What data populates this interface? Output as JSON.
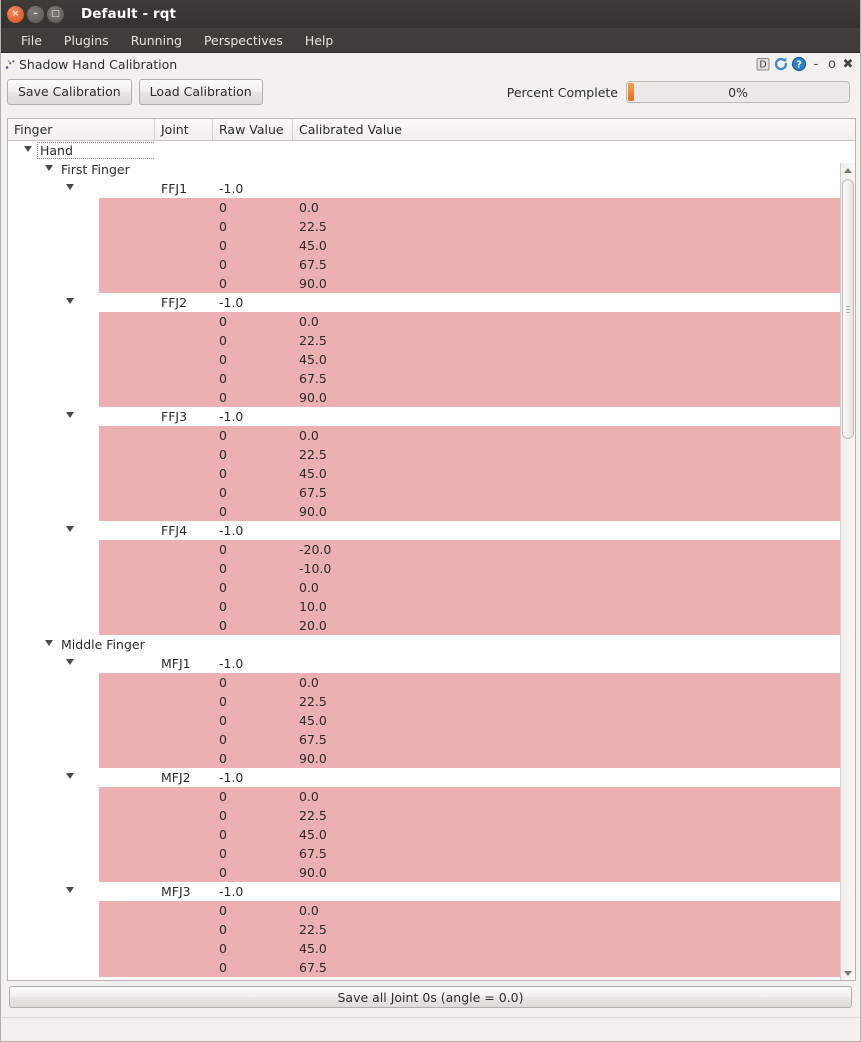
{
  "window": {
    "title": "Default - rqt",
    "buttons": [
      {
        "name": "close",
        "glyph": "×"
      },
      {
        "name": "minimize",
        "glyph": "–"
      },
      {
        "name": "maximize",
        "glyph": "□"
      }
    ]
  },
  "menubar": {
    "items": [
      "File",
      "Plugins",
      "Running",
      "Perspectives",
      "Help"
    ]
  },
  "dock": {
    "title": "Shadow Hand Calibration",
    "icon": "plugin-icon",
    "buttons": [
      {
        "name": "dock-d-button",
        "label": "D"
      },
      {
        "name": "reload-button",
        "label": "↻"
      },
      {
        "name": "help-button",
        "label": "?"
      },
      {
        "name": "minimize-button",
        "label": "-"
      },
      {
        "name": "float-button",
        "label": "o"
      },
      {
        "name": "close-button",
        "label": "✖"
      }
    ]
  },
  "toolbar": {
    "save_calibration_label": "Save Calibration",
    "load_calibration_label": "Load Calibration",
    "percent_complete_label": "Percent Complete",
    "percent_complete_value": "0%",
    "percent_complete_number": 0,
    "progress_accent_color": "#e8701b"
  },
  "tree": {
    "columns": [
      "Finger",
      "Joint",
      "Raw Value",
      "Calibrated Value"
    ],
    "data_row_color": "#ecb0b3",
    "rows": [
      {
        "kind": "node",
        "level": 0,
        "label": "Hand",
        "focused": true,
        "joint": "",
        "raw": "",
        "cal": ""
      },
      {
        "kind": "node",
        "level": 1,
        "label": "First Finger",
        "focused": false,
        "joint": "",
        "raw": "",
        "cal": ""
      },
      {
        "kind": "node",
        "level": 2,
        "label": "",
        "focused": false,
        "joint": "FFJ1",
        "raw": "-1.0",
        "cal": ""
      },
      {
        "kind": "data",
        "joint": "",
        "raw": "0",
        "cal": "0.0"
      },
      {
        "kind": "data",
        "joint": "",
        "raw": "0",
        "cal": "22.5"
      },
      {
        "kind": "data",
        "joint": "",
        "raw": "0",
        "cal": "45.0"
      },
      {
        "kind": "data",
        "joint": "",
        "raw": "0",
        "cal": "67.5"
      },
      {
        "kind": "data",
        "joint": "",
        "raw": "0",
        "cal": "90.0"
      },
      {
        "kind": "node",
        "level": 2,
        "label": "",
        "focused": false,
        "joint": "FFJ2",
        "raw": "-1.0",
        "cal": ""
      },
      {
        "kind": "data",
        "joint": "",
        "raw": "0",
        "cal": "0.0"
      },
      {
        "kind": "data",
        "joint": "",
        "raw": "0",
        "cal": "22.5"
      },
      {
        "kind": "data",
        "joint": "",
        "raw": "0",
        "cal": "45.0"
      },
      {
        "kind": "data",
        "joint": "",
        "raw": "0",
        "cal": "67.5"
      },
      {
        "kind": "data",
        "joint": "",
        "raw": "0",
        "cal": "90.0"
      },
      {
        "kind": "node",
        "level": 2,
        "label": "",
        "focused": false,
        "joint": "FFJ3",
        "raw": "-1.0",
        "cal": ""
      },
      {
        "kind": "data",
        "joint": "",
        "raw": "0",
        "cal": "0.0"
      },
      {
        "kind": "data",
        "joint": "",
        "raw": "0",
        "cal": "22.5"
      },
      {
        "kind": "data",
        "joint": "",
        "raw": "0",
        "cal": "45.0"
      },
      {
        "kind": "data",
        "joint": "",
        "raw": "0",
        "cal": "67.5"
      },
      {
        "kind": "data",
        "joint": "",
        "raw": "0",
        "cal": "90.0"
      },
      {
        "kind": "node",
        "level": 2,
        "label": "",
        "focused": false,
        "joint": "FFJ4",
        "raw": "-1.0",
        "cal": ""
      },
      {
        "kind": "data",
        "joint": "",
        "raw": "0",
        "cal": "-20.0"
      },
      {
        "kind": "data",
        "joint": "",
        "raw": "0",
        "cal": "-10.0"
      },
      {
        "kind": "data",
        "joint": "",
        "raw": "0",
        "cal": "0.0"
      },
      {
        "kind": "data",
        "joint": "",
        "raw": "0",
        "cal": "10.0"
      },
      {
        "kind": "data",
        "joint": "",
        "raw": "0",
        "cal": "20.0"
      },
      {
        "kind": "node",
        "level": 1,
        "label": "Middle Finger",
        "focused": false,
        "joint": "",
        "raw": "",
        "cal": ""
      },
      {
        "kind": "node",
        "level": 2,
        "label": "",
        "focused": false,
        "joint": "MFJ1",
        "raw": "-1.0",
        "cal": ""
      },
      {
        "kind": "data",
        "joint": "",
        "raw": "0",
        "cal": "0.0"
      },
      {
        "kind": "data",
        "joint": "",
        "raw": "0",
        "cal": "22.5"
      },
      {
        "kind": "data",
        "joint": "",
        "raw": "0",
        "cal": "45.0"
      },
      {
        "kind": "data",
        "joint": "",
        "raw": "0",
        "cal": "67.5"
      },
      {
        "kind": "data",
        "joint": "",
        "raw": "0",
        "cal": "90.0"
      },
      {
        "kind": "node",
        "level": 2,
        "label": "",
        "focused": false,
        "joint": "MFJ2",
        "raw": "-1.0",
        "cal": ""
      },
      {
        "kind": "data",
        "joint": "",
        "raw": "0",
        "cal": "0.0"
      },
      {
        "kind": "data",
        "joint": "",
        "raw": "0",
        "cal": "22.5"
      },
      {
        "kind": "data",
        "joint": "",
        "raw": "0",
        "cal": "45.0"
      },
      {
        "kind": "data",
        "joint": "",
        "raw": "0",
        "cal": "67.5"
      },
      {
        "kind": "data",
        "joint": "",
        "raw": "0",
        "cal": "90.0"
      },
      {
        "kind": "node",
        "level": 2,
        "label": "",
        "focused": false,
        "joint": "MFJ3",
        "raw": "-1.0",
        "cal": ""
      },
      {
        "kind": "data",
        "joint": "",
        "raw": "0",
        "cal": "0.0"
      },
      {
        "kind": "data",
        "joint": "",
        "raw": "0",
        "cal": "22.5"
      },
      {
        "kind": "data",
        "joint": "",
        "raw": "0",
        "cal": "45.0"
      },
      {
        "kind": "data",
        "joint": "",
        "raw": "0",
        "cal": "67.5"
      }
    ]
  },
  "footer": {
    "save_all_label": "Save all Joint 0s (angle = 0.0)"
  }
}
